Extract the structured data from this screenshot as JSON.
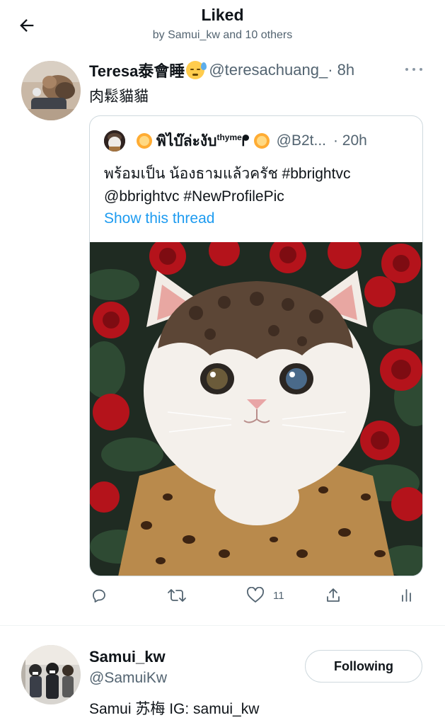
{
  "header": {
    "title": "Liked",
    "subtitle": "by Samui_kw and 10 others",
    "back_icon": "arrow-left-icon"
  },
  "tweet": {
    "author_name": "Teresa泰會睡",
    "author_emoji": "sleepy-face-emoji",
    "handle": "@teresachuang_",
    "time": "· 8h",
    "text": "肉鬆貓貓",
    "more_icon": "more-horizontal-icon",
    "quoted": {
      "name_prefix": "พิไบ๊ล่ะงับ",
      "name_sup": "thyme",
      "name_suffix": "ᖰ",
      "emoji": "sun-with-face-emoji",
      "handle": "@B2t...",
      "time": "· 20h",
      "text_line1": "พร้อมเป็น น้องธามแล้วครัช #bbrightvc",
      "text_line2": "@bbrightvc  #NewProfilePic",
      "show_thread": "Show this thread",
      "image": "cat-wearing-wig-and-leopard-shirt-photo"
    },
    "actions": {
      "reply_icon": "reply-icon",
      "retweet_icon": "retweet-icon",
      "like_icon": "heart-icon",
      "like_count": "11",
      "share_icon": "share-icon",
      "analytics_icon": "analytics-icon"
    }
  },
  "user": {
    "name": "Samui_kw",
    "handle": "@SamuiKw",
    "bio": "Samui 苏梅 IG: samui_kw",
    "follow_label": "Following"
  },
  "colors": {
    "link": "#1d9bf0",
    "secondary_text": "#536471",
    "border": "#cfd9de"
  }
}
